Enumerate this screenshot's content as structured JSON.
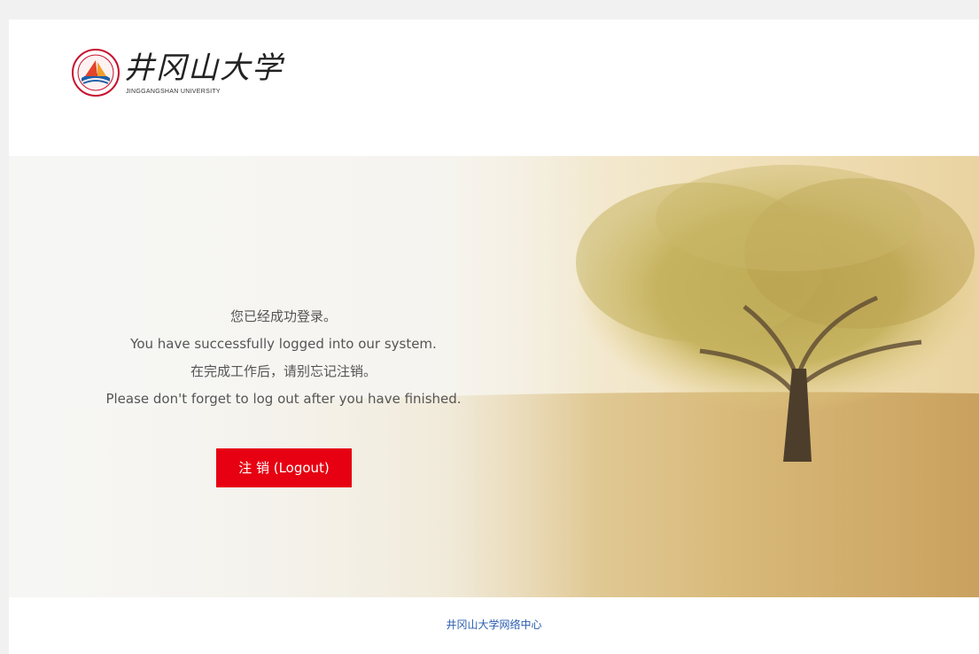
{
  "header": {
    "logo_title": "井冈山大学",
    "logo_subtitle": "JINGGANGSHAN UNIVERSITY"
  },
  "message": {
    "line1_zh": "您已经成功登录。",
    "line2_en": "You have successfully logged into our system.",
    "line3_zh": "在完成工作后，请别忘记注销。",
    "line4_en": "Please don't forget to log out after you have finished."
  },
  "logout_button": {
    "label": "注 销 (Logout)",
    "color": "#e60012"
  },
  "footer": {
    "link_text": "井冈山大学网络中心",
    "link_color": "#2a5db0"
  }
}
